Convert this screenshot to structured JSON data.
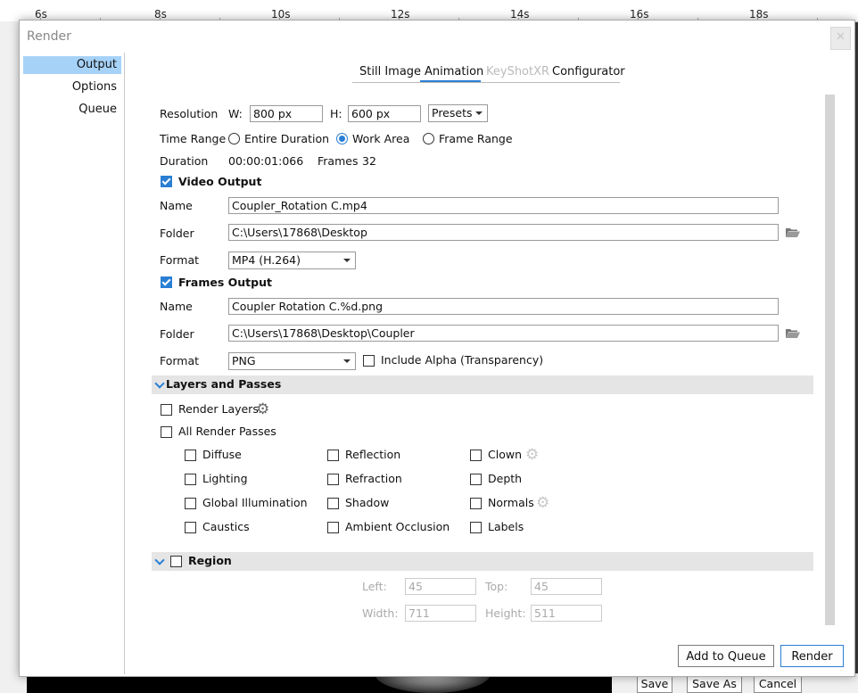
{
  "timeline": {
    "labels": [
      "6s",
      "8s",
      "10s",
      "12s",
      "14s",
      "16s",
      "18s"
    ]
  },
  "background_buttons": {
    "save": "Save",
    "save_as": "Save As",
    "cancel": "Cancel"
  },
  "dialog": {
    "title": "Render",
    "close_glyph": "✕"
  },
  "sidebar": {
    "items": [
      {
        "label": "Output",
        "active": true
      },
      {
        "label": "Options",
        "active": false
      },
      {
        "label": "Queue",
        "active": false
      }
    ]
  },
  "tabs": [
    {
      "label": "Still Image",
      "state": "normal"
    },
    {
      "label": "Animation",
      "state": "active"
    },
    {
      "label": "KeyShotXR",
      "state": "disabled"
    },
    {
      "label": "Configurator",
      "state": "normal"
    }
  ],
  "resolution": {
    "label": "Resolution",
    "w_label": "W:",
    "w_value": "800 px",
    "h_label": "H:",
    "h_value": "600 px",
    "presets_label": "Presets"
  },
  "time_range": {
    "label": "Time Range",
    "options": [
      {
        "label": "Entire Duration",
        "checked": false
      },
      {
        "label": "Work Area",
        "checked": true
      },
      {
        "label": "Frame Range",
        "checked": false
      }
    ]
  },
  "duration": {
    "label": "Duration",
    "value": "00:00:01:066",
    "frames_label": "Frames",
    "frames_value": "32"
  },
  "video_output": {
    "label": "Video Output",
    "checked": true,
    "name_label": "Name",
    "name_value": "Coupler_Rotation C.mp4",
    "folder_label": "Folder",
    "folder_value": "C:\\Users\\17868\\Desktop",
    "format_label": "Format",
    "format_value": "MP4 (H.264)"
  },
  "frames_output": {
    "label": "Frames Output",
    "checked": true,
    "name_label": "Name",
    "name_value": "Coupler Rotation C.%d.png",
    "folder_label": "Folder",
    "folder_value": "C:\\Users\\17868\\Desktop\\Coupler",
    "format_label": "Format",
    "format_value": "PNG",
    "alpha_label": "Include Alpha (Transparency)",
    "alpha_checked": false
  },
  "layers": {
    "header": "Layers and Passes",
    "render_layers_label": "Render Layers",
    "all_passes_label": "All Render Passes",
    "passes": [
      [
        "Diffuse",
        "Lighting",
        "Global Illumination",
        "Caustics"
      ],
      [
        "Reflection",
        "Refraction",
        "Shadow",
        "Ambient Occlusion"
      ],
      [
        "Clown",
        "Depth",
        "Normals",
        "Labels"
      ]
    ]
  },
  "region": {
    "header": "Region",
    "left_label": "Left:",
    "left_value": "45",
    "top_label": "Top:",
    "top_value": "45",
    "width_label": "Width:",
    "width_value": "711",
    "height_label": "Height:",
    "height_value": "511"
  },
  "buttons": {
    "add_to_queue": "Add to Queue",
    "render": "Render"
  },
  "colors": {
    "accent": "#2a7fd4",
    "sidebar_active": "#a6d2f8",
    "section_bar": "#e5e5e5"
  }
}
